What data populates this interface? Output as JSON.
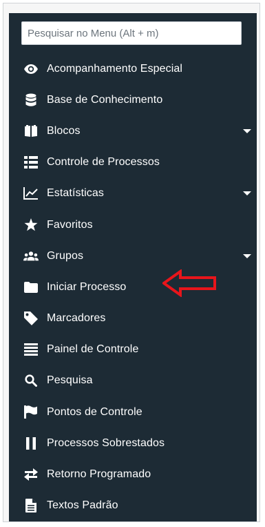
{
  "search": {
    "placeholder": "Pesquisar no Menu (Alt + m)"
  },
  "menu": {
    "items": [
      {
        "label": "Acompanhamento Especial",
        "icon": "eye-icon",
        "has_submenu": false
      },
      {
        "label": "Base de Conhecimento",
        "icon": "database-icon",
        "has_submenu": false
      },
      {
        "label": "Blocos",
        "icon": "book-icon",
        "has_submenu": true
      },
      {
        "label": "Controle de Processos",
        "icon": "table-list-icon",
        "has_submenu": false
      },
      {
        "label": "Estatísticas",
        "icon": "line-chart-icon",
        "has_submenu": true
      },
      {
        "label": "Favoritos",
        "icon": "star-icon",
        "has_submenu": false
      },
      {
        "label": "Grupos",
        "icon": "users-icon",
        "has_submenu": true
      },
      {
        "label": "Iniciar Processo",
        "icon": "folder-icon",
        "has_submenu": false
      },
      {
        "label": "Marcadores",
        "icon": "tag-icon",
        "has_submenu": false
      },
      {
        "label": "Painel de Controle",
        "icon": "bars-icon",
        "has_submenu": false
      },
      {
        "label": "Pesquisa",
        "icon": "search-icon",
        "has_submenu": false
      },
      {
        "label": "Pontos de Controle",
        "icon": "flag-icon",
        "has_submenu": false
      },
      {
        "label": "Processos Sobrestados",
        "icon": "pause-icon",
        "has_submenu": false
      },
      {
        "label": "Retorno Programado",
        "icon": "exchange-icon",
        "has_submenu": false
      },
      {
        "label": "Textos Padrão",
        "icon": "file-text-icon",
        "has_submenu": false
      }
    ]
  },
  "colors": {
    "menu_background": "#1d2b35",
    "text": "#ffffff",
    "annotation_arrow": "#e8151b"
  },
  "annotation": {
    "type": "arrow",
    "points_to": "Iniciar Processo"
  }
}
